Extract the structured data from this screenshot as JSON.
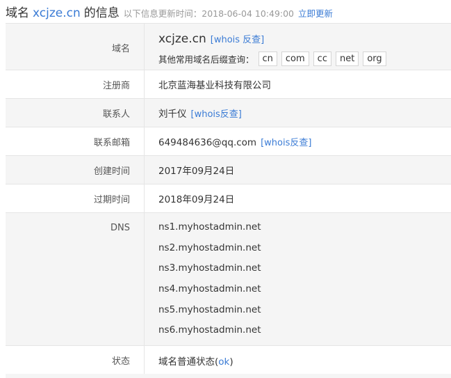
{
  "header": {
    "prefix": "域名",
    "domain": "xcjze.cn",
    "suffix": "的信息",
    "update_text": "以下信息更新时间：2018-06-04 10:49:00",
    "update_link": "立即更新"
  },
  "rows": {
    "domain": {
      "label": "域名",
      "value": "xcjze.cn",
      "whois_link": "[whois 反查]",
      "suffix_label": "其他常用域名后缀查询：",
      "suffixes": [
        "cn",
        "com",
        "cc",
        "net",
        "org"
      ]
    },
    "registrar": {
      "label": "注册商",
      "value": "北京蓝海基业科技有限公司"
    },
    "contact": {
      "label": "联系人",
      "value": "刘千仪",
      "whois_link": "[whois反查]"
    },
    "email": {
      "label": "联系邮箱",
      "value": "649484636@qq.com",
      "whois_link": "[whois反查]"
    },
    "created": {
      "label": "创建时间",
      "value": "2017年09月24日"
    },
    "expires": {
      "label": "过期时间",
      "value": "2018年09月24日"
    },
    "dns": {
      "label": "DNS",
      "servers": [
        "ns1.myhostadmin.net",
        "ns2.myhostadmin.net",
        "ns3.myhostadmin.net",
        "ns4.myhostadmin.net",
        "ns5.myhostadmin.net",
        "ns6.myhostadmin.net"
      ]
    },
    "status": {
      "label": "状态",
      "value_prefix": "域名普通状态(",
      "value_link": "ok",
      "value_suffix": ")"
    }
  },
  "colors": {
    "link": "#3a7bd5",
    "row_alt": "#f5f5f5",
    "border": "#e5e5e5"
  }
}
